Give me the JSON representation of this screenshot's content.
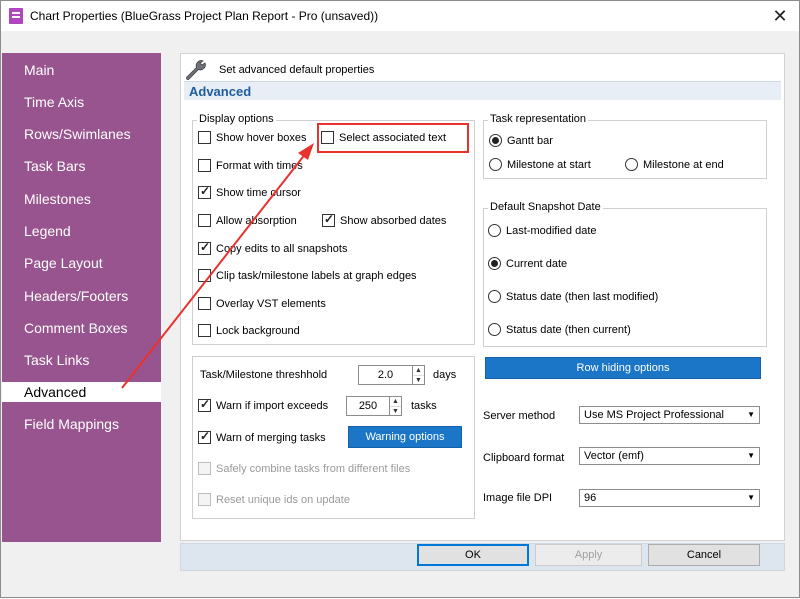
{
  "window": {
    "title": "Chart Properties (BlueGrass Project Plan Report - Pro (unsaved))",
    "close_glyph": "✕"
  },
  "sidebar": {
    "items": [
      {
        "label": "Main",
        "selected": false
      },
      {
        "label": "Time Axis",
        "selected": false
      },
      {
        "label": "Rows/Swimlanes",
        "selected": false
      },
      {
        "label": "Task Bars",
        "selected": false
      },
      {
        "label": "Milestones",
        "selected": false
      },
      {
        "label": "Legend",
        "selected": false
      },
      {
        "label": "Page Layout",
        "selected": false
      },
      {
        "label": "Headers/Footers",
        "selected": false
      },
      {
        "label": "Comment Boxes",
        "selected": false
      },
      {
        "label": "Task Links",
        "selected": false
      },
      {
        "label": "Advanced",
        "selected": true
      },
      {
        "label": "Field Mappings",
        "selected": false
      }
    ]
  },
  "header": {
    "icon": "wrench-icon",
    "text": "Set advanced default properties",
    "section": "Advanced"
  },
  "display_options": {
    "legend": "Display options",
    "show_hover_boxes": {
      "label": "Show hover boxes",
      "checked": false
    },
    "select_associated_text": {
      "label": "Select associated text",
      "checked": false
    },
    "format_with_times": {
      "label": "Format with times",
      "checked": false
    },
    "show_time_cursor": {
      "label": "Show time cursor",
      "checked": true
    },
    "allow_absorption": {
      "label": "Allow absorption",
      "checked": false
    },
    "show_absorbed_dates": {
      "label": "Show absorbed dates",
      "checked": true
    },
    "copy_edits": {
      "label": "Copy edits to all snapshots",
      "checked": true
    },
    "clip_labels": {
      "label": "Clip task/milestone labels at graph edges",
      "checked": false
    },
    "overlay_vst": {
      "label": "Overlay VST elements",
      "checked": false
    },
    "lock_background": {
      "label": "Lock background",
      "checked": false
    }
  },
  "task_representation": {
    "legend": "Task representation",
    "gantt_bar": {
      "label": "Gantt bar",
      "selected": true
    },
    "milestone_start": {
      "label": "Milestone at start",
      "selected": false
    },
    "milestone_end": {
      "label": "Milestone at end",
      "selected": false
    }
  },
  "snapshot_date": {
    "legend": "Default Snapshot Date",
    "last_modified": {
      "label": "Last-modified date",
      "selected": false
    },
    "current_date": {
      "label": "Current date",
      "selected": true
    },
    "status_last_modified": {
      "label": "Status date (then last modified)",
      "selected": false
    },
    "status_current": {
      "label": "Status date (then current)",
      "selected": false
    }
  },
  "thresholds": {
    "threshold_label": "Task/Milestone threshhold",
    "threshold_value": "2.0",
    "threshold_unit": "days",
    "warn_import": {
      "label": "Warn if import exceeds",
      "checked": true
    },
    "import_value": "250",
    "import_unit": "tasks",
    "warn_merging": {
      "label": "Warn of merging tasks",
      "checked": true
    },
    "warning_options_label": "Warning options",
    "safely_combine": {
      "label": "Safely combine tasks from different files",
      "checked": false
    },
    "reset_ids": {
      "label": "Reset unique ids on update",
      "checked": false
    }
  },
  "row_hiding_label": "Row hiding options",
  "server_method": {
    "label": "Server method",
    "value": "Use MS Project Professional"
  },
  "clipboard_format": {
    "label": "Clipboard format",
    "value": "Vector (emf)"
  },
  "image_dpi": {
    "label": "Image file DPI",
    "value": "96"
  },
  "footer": {
    "ok": "OK",
    "apply": "Apply",
    "cancel": "Cancel"
  },
  "colors": {
    "sidebar": "#98548e",
    "accent_blue": "#1b76c7",
    "highlight_red": "#e8322e",
    "section_title": "#1f5c9e"
  }
}
